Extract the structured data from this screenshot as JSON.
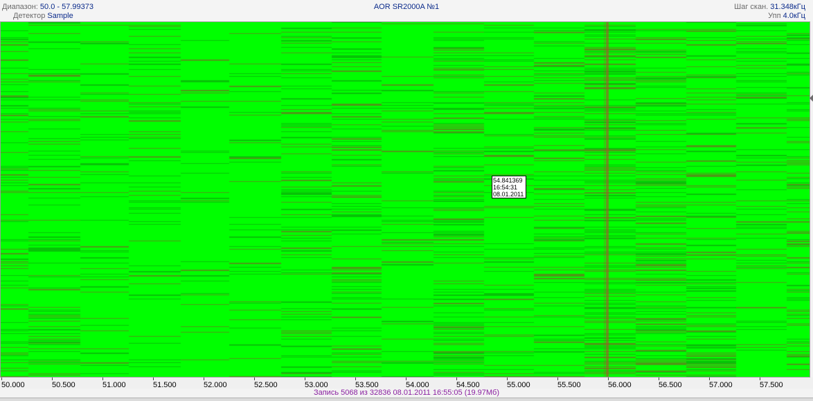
{
  "header": {
    "range_label": "Диапазон:",
    "range_value": "50.0 - 57.99373",
    "detector_label": "Детектор",
    "detector_value": "Sample",
    "device_title": "AOR SR2000A №1",
    "scan_step_label": "Шаг скан.",
    "scan_step_value": "31.348кГц",
    "ipp_label": "Упп",
    "ipp_value": "4.0кГц"
  },
  "colors": {
    "waterfall_background": "#00ff00",
    "signal_trace": "#a05a2c",
    "header_value": "#0a2a8a",
    "status_text": "#8a1fa0"
  },
  "tooltip": {
    "frequency": "54.841369",
    "time": "16:54:31",
    "date": "08.01.2011"
  },
  "axis": {
    "ticks": [
      "50.000",
      "50.500",
      "51.000",
      "51.500",
      "52.000",
      "52.500",
      "53.000",
      "53.500",
      "54.000",
      "54.500",
      "55.000",
      "55.500",
      "56.000",
      "56.500",
      "57.000",
      "57.500"
    ]
  },
  "waterfall": {
    "freq_min": 50.0,
    "freq_max": 57.99373,
    "strong_signal_freq": 56.0
  },
  "status": {
    "text": "Запись 5068  из 32836   08.01.2011 16:55:05 (19.97Мб)"
  }
}
